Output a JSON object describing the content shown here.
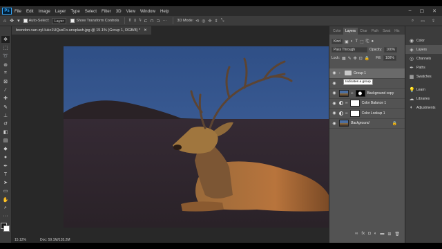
{
  "menubar": {
    "logo": "Ps",
    "items": [
      "File",
      "Edit",
      "Image",
      "Layer",
      "Type",
      "Select",
      "Filter",
      "3D",
      "View",
      "Window",
      "Help"
    ],
    "window_controls": [
      "–",
      "▢",
      "✕"
    ]
  },
  "options": {
    "auto_select_label": "Auto-Select:",
    "auto_select_value": "Layer",
    "show_transform_label": "Show Transform Controls",
    "mode_label": "3D Mode:"
  },
  "document": {
    "tab_title": "brendon-van-zyl-Iukc1UQusFo-unsplash.jpg @ 15.1% (Group 1, RGB/8) *",
    "tab_close": "✕"
  },
  "status": {
    "zoom": "15.12%",
    "doc": "Doc: 59.1M/135.2M"
  },
  "layers_panel": {
    "tabs": [
      "Color",
      "Layers",
      "Char",
      "Path",
      "Swat",
      "His"
    ],
    "active_tab": "Layers",
    "kind_label": "Kind",
    "blend_mode": "Pass Through",
    "opacity_label": "Opacity:",
    "opacity_value": "100%",
    "lock_label": "Lock:",
    "fill_label": "Fill:",
    "fill_value": "100%",
    "layers": [
      {
        "name": "Group 1",
        "type": "group",
        "selected": true
      },
      {
        "name": "",
        "type": "spacer"
      },
      {
        "name": "Background copy",
        "type": "pixel"
      },
      {
        "name": "Color Balance 1",
        "type": "adjustment"
      },
      {
        "name": "Color Lookup 1",
        "type": "adjustment"
      },
      {
        "name": "Background",
        "type": "background"
      }
    ],
    "tooltip": "Indicates a group"
  },
  "strip": {
    "items": [
      "Color",
      "Layers",
      "Channels",
      "Paths",
      "Swatches",
      "Learn",
      "Libraries",
      "Adjustments"
    ],
    "active": "Layers"
  },
  "colors": {
    "app_dark": "#2b2b2b",
    "panel": "#535353",
    "sky": "#38588f",
    "deer": "#8b5a2b",
    "heather": "#3a2f38",
    "ps_blue": "#31a8ff"
  }
}
